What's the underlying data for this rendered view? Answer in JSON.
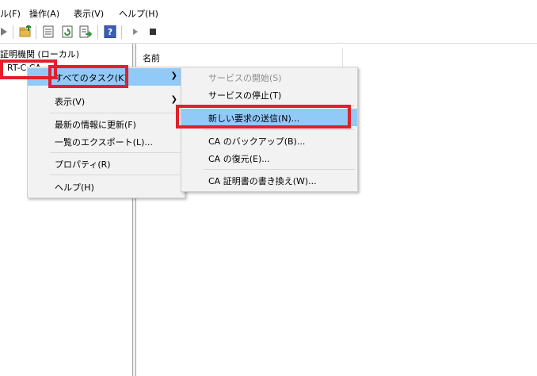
{
  "menubar": {
    "items": [
      {
        "label": "ル(F)"
      },
      {
        "label": "操作(A)"
      },
      {
        "label": "表示(V)"
      },
      {
        "label": "ヘルプ(H)"
      }
    ]
  },
  "toolbar": {
    "icons": [
      "forward-icon",
      "folder-up-icon",
      "properties-icon",
      "refresh-icon",
      "export-list-icon",
      "help-icon",
      "play-icon",
      "stop-icon"
    ]
  },
  "tree": {
    "root_label": "証明機関 (ローカル)",
    "child_label": "RT-C  CA"
  },
  "list": {
    "column_name": "名前"
  },
  "context_menu": {
    "items": [
      {
        "label": "すべてのタスク(K)",
        "submenu": true
      },
      {
        "label": "表示(V)",
        "submenu": true
      },
      {
        "label": "最新の情報に更新(F)"
      },
      {
        "label": "一覧のエクスポート(L)..."
      },
      {
        "label": "プロパティ(R)"
      },
      {
        "label": "ヘルプ(H)"
      }
    ]
  },
  "submenu": {
    "items": [
      {
        "label": "サービスの開始(S)",
        "disabled": true
      },
      {
        "label": "サービスの停止(T)"
      },
      {
        "label": "新しい要求の送信(N)..."
      },
      {
        "label": "CA のバックアップ(B)..."
      },
      {
        "label": "CA の復元(E)..."
      },
      {
        "label": "CA 証明書の書き換え(W)..."
      }
    ]
  },
  "colors": {
    "highlight": "#91c9f7",
    "annotation_red": "#e0202a",
    "menu_bg": "#f2f2f2"
  }
}
